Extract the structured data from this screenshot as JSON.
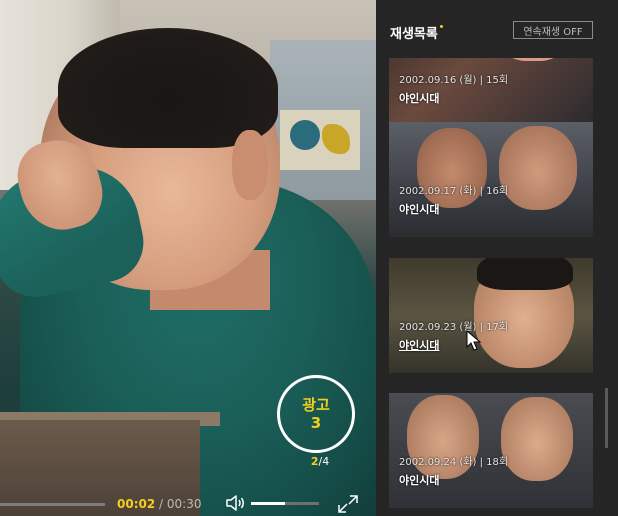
{
  "player": {
    "ad": {
      "label": "광고",
      "countdown": "3",
      "current": "2",
      "separator": "/",
      "total": "4"
    },
    "time": {
      "current": "00:02",
      "separator": "/",
      "duration": "00:30"
    },
    "progress_fraction": 0.07,
    "volume_fraction": 0.5,
    "icons": {
      "volume": "speaker-icon",
      "fullscreen": "expand-icon"
    }
  },
  "playlist": {
    "title": "재생목록",
    "autoplay_label": "연속재생 OFF",
    "accent_color": "#f2cf1e",
    "items": [
      {
        "meta": "2002.09.16 (월) | 15회",
        "name": "야인시대"
      },
      {
        "meta": "2002.09.17 (화) | 16회",
        "name": "야인시대"
      },
      {
        "meta": "2002.09.23 (월) | 17회",
        "name": "야인시대"
      },
      {
        "meta": "2002.09.24 (화) | 18회",
        "name": "야인시대"
      }
    ]
  }
}
